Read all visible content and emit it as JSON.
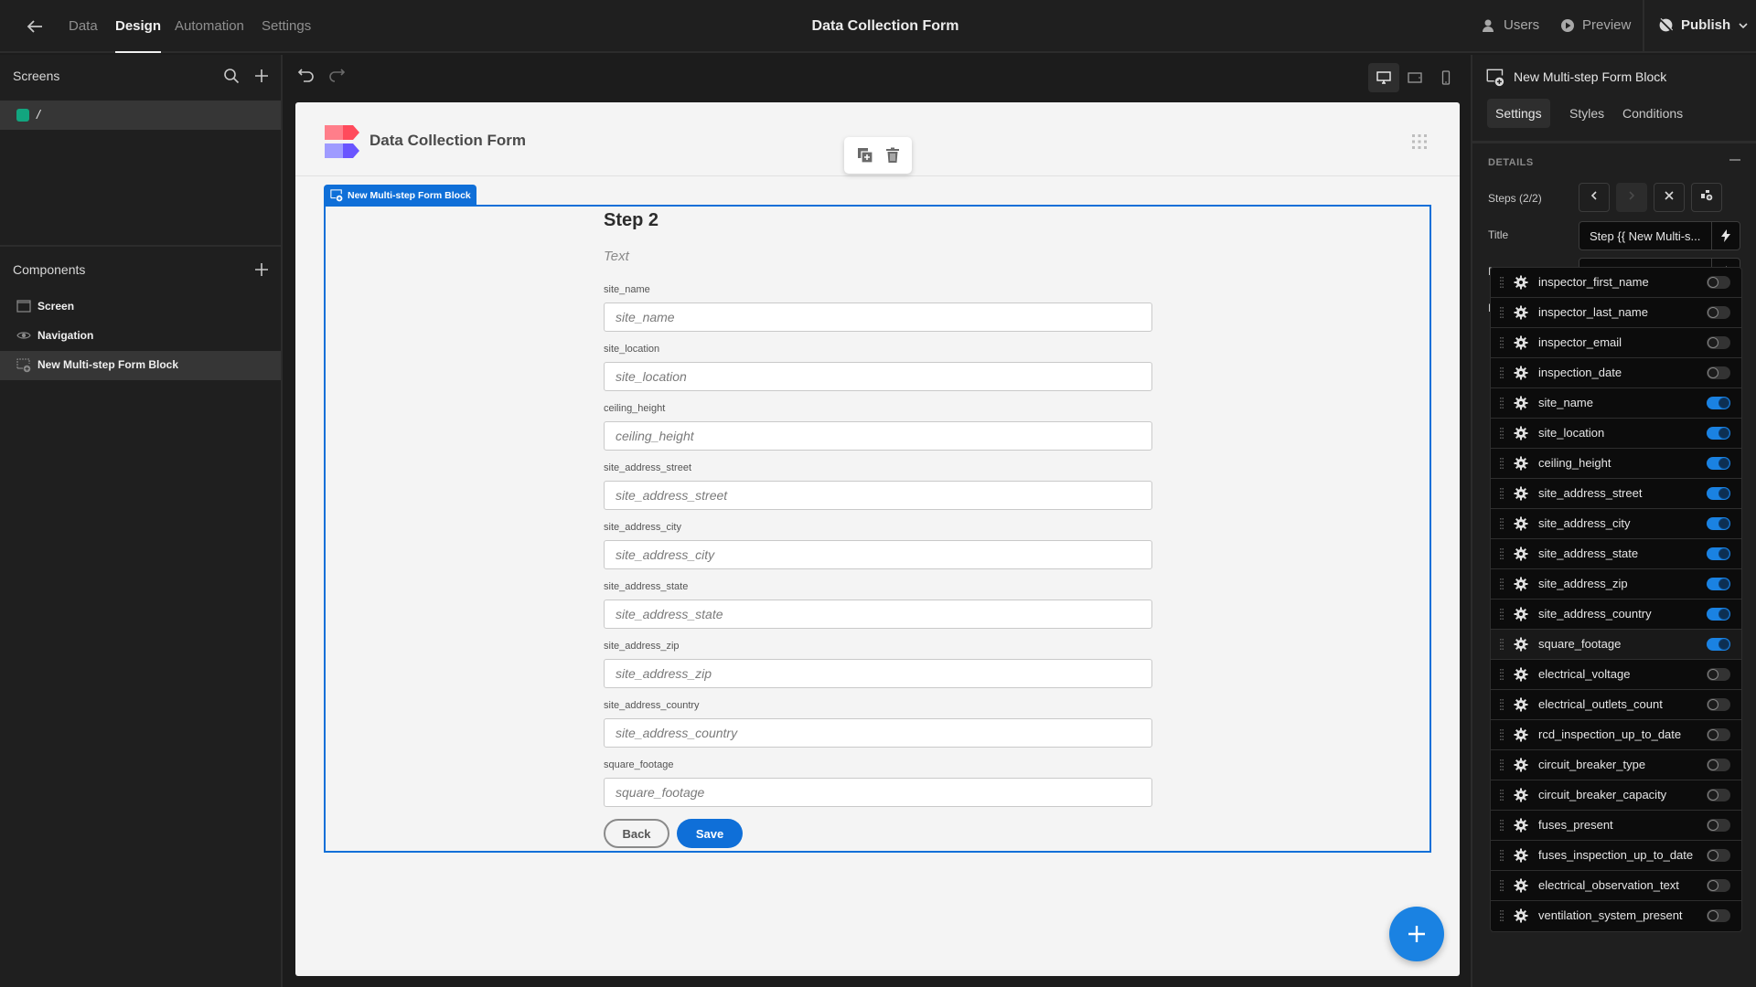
{
  "topbar": {
    "nav": [
      {
        "label": "Data",
        "active": false
      },
      {
        "label": "Design",
        "active": true
      },
      {
        "label": "Automation",
        "active": false
      },
      {
        "label": "Settings",
        "active": false
      }
    ],
    "app_title": "Data Collection Form",
    "users_label": "Users",
    "preview_label": "Preview",
    "publish_label": "Publish"
  },
  "left_panel": {
    "screens_heading": "Screens",
    "screens": [
      {
        "path": "/",
        "color": "#12a57f"
      }
    ],
    "components_heading": "Components",
    "components": [
      {
        "label": "Screen",
        "icon": "screen-icon",
        "selected": false
      },
      {
        "label": "Navigation",
        "icon": "eye-icon",
        "selected": false
      },
      {
        "label": "New Multi-step Form Block",
        "icon": "form-block-icon",
        "selected": true
      }
    ]
  },
  "canvas": {
    "app_title": "Data Collection Form",
    "block_tag": "New Multi-step Form Block",
    "form": {
      "step_title": "Step 2",
      "step_description": "Text",
      "fields": [
        {
          "label": "site_name",
          "placeholder": "site_name"
        },
        {
          "label": "site_location",
          "placeholder": "site_location"
        },
        {
          "label": "ceiling_height",
          "placeholder": "ceiling_height"
        },
        {
          "label": "site_address_street",
          "placeholder": "site_address_street"
        },
        {
          "label": "site_address_city",
          "placeholder": "site_address_city"
        },
        {
          "label": "site_address_state",
          "placeholder": "site_address_state"
        },
        {
          "label": "site_address_zip",
          "placeholder": "site_address_zip"
        },
        {
          "label": "site_address_country",
          "placeholder": "site_address_country"
        },
        {
          "label": "square_footage",
          "placeholder": "square_footage"
        }
      ],
      "back_label": "Back",
      "save_label": "Save"
    },
    "accent_color": "#0f6fd8"
  },
  "right_panel": {
    "title": "New Multi-step Form Block",
    "tabs": [
      {
        "label": "Settings",
        "active": true
      },
      {
        "label": "Styles",
        "active": false
      },
      {
        "label": "Conditions",
        "active": false
      }
    ],
    "details_heading": "DETAILS",
    "steps_label": "Steps (2/2)",
    "title_label": "Title",
    "title_value": "Step {{ New Multi-s...",
    "description_label": "Description",
    "description_value": "",
    "fields_label": "Fields",
    "fields_master_on": false,
    "fields": [
      {
        "name": "inspector_first_name",
        "on": false
      },
      {
        "name": "inspector_last_name",
        "on": false
      },
      {
        "name": "inspector_email",
        "on": false
      },
      {
        "name": "inspection_date",
        "on": false
      },
      {
        "name": "site_name",
        "on": true
      },
      {
        "name": "site_location",
        "on": true
      },
      {
        "name": "ceiling_height",
        "on": true
      },
      {
        "name": "site_address_street",
        "on": true
      },
      {
        "name": "site_address_city",
        "on": true
      },
      {
        "name": "site_address_state",
        "on": true
      },
      {
        "name": "site_address_zip",
        "on": true
      },
      {
        "name": "site_address_country",
        "on": true
      },
      {
        "name": "square_footage",
        "on": true
      },
      {
        "name": "electrical_voltage",
        "on": false
      },
      {
        "name": "electrical_outlets_count",
        "on": false
      },
      {
        "name": "rcd_inspection_up_to_date",
        "on": false
      },
      {
        "name": "circuit_breaker_type",
        "on": false
      },
      {
        "name": "circuit_breaker_capacity",
        "on": false
      },
      {
        "name": "fuses_present",
        "on": false
      },
      {
        "name": "fuses_inspection_up_to_date",
        "on": false
      },
      {
        "name": "electrical_observation_text",
        "on": false
      },
      {
        "name": "ventilation_system_present",
        "on": false
      }
    ]
  }
}
